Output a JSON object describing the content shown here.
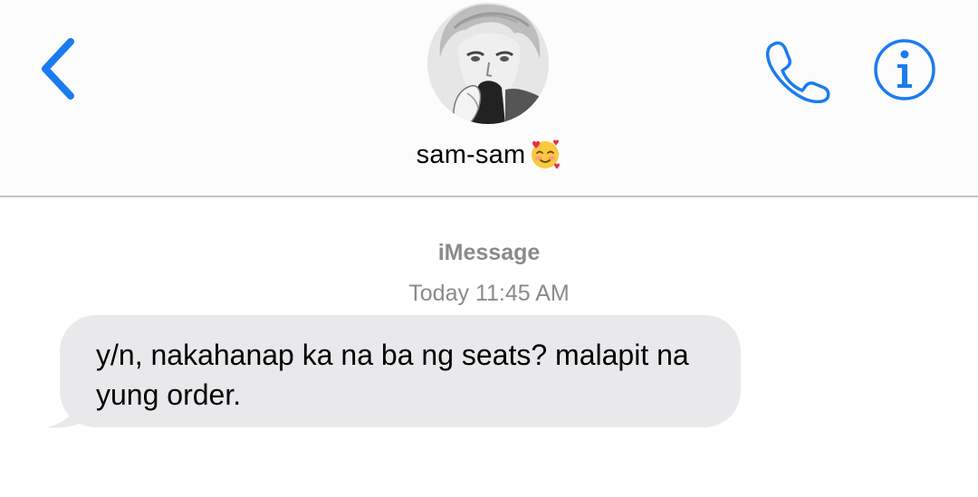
{
  "header": {
    "back_icon": "chevron-left-icon",
    "contact_name": "sam-sam",
    "contact_emoji": "smiling-face-with-hearts-icon",
    "call_icon": "phone-icon",
    "info_icon": "info-icon",
    "accent_color": "#1a7cf0"
  },
  "conversation": {
    "service": "iMessage",
    "timestamp_day": "Today",
    "timestamp_time": "11:45 AM",
    "messages": [
      {
        "direction": "incoming",
        "text": "y/n, nakahanap ka na ba ng seats? malapit na yung order.",
        "bubble_color": "#e9e9eb"
      }
    ]
  }
}
